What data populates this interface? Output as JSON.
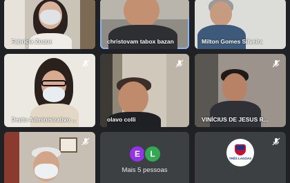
{
  "participants": [
    {
      "name": "Fabrícia Zuque",
      "muted": false
    },
    {
      "name": "christovam tabox bazan",
      "muted": false,
      "speaking": true
    },
    {
      "name": "Milton Gomes Silveira",
      "muted": false
    },
    {
      "name": "Depto Administrativo ...",
      "muted": true
    },
    {
      "name": "olavo colli",
      "muted": true
    },
    {
      "name": "VINÍCIUS DE JESUS R...",
      "muted": true
    },
    {
      "name": "",
      "muted": true
    },
    {
      "name": "",
      "muted": true
    },
    {
      "name": "",
      "muted": true
    }
  ],
  "more": {
    "avatars": [
      {
        "letter": "E",
        "color": "#9334e6"
      },
      {
        "letter": "L",
        "color": "#34a853"
      }
    ],
    "label": "Mais 5 pessoas"
  },
  "logo_text": "TRÊS LAGOAS",
  "colors": {
    "background": "#202124",
    "tile": "#3c4043",
    "speaking_outline": "#8ab4f8"
  }
}
